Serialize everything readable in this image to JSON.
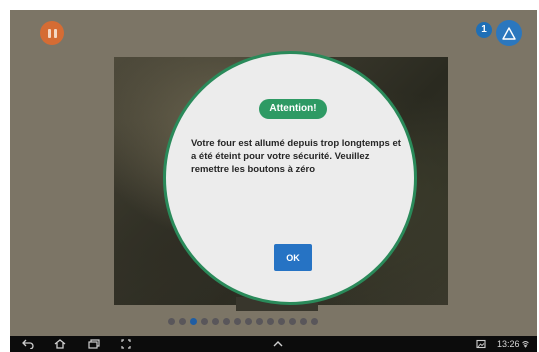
{
  "top_bar": {
    "pause_icon": "pause-icon",
    "notification_count": "1",
    "alert_icon": "warning-triangle-icon"
  },
  "dialog": {
    "title": "Attention!",
    "message": "Votre four est allumé depuis trop longtemps et a été éteint pour votre sécurité. Veuillez remettre les boutons à zéro",
    "ok_label": "OK",
    "colors": {
      "border": "#2a8a5a",
      "title_bg": "#2e9a64",
      "button_bg": "#2673c4"
    }
  },
  "carousel": {
    "dot_count": 14,
    "active_index": 2
  },
  "system_bar": {
    "icons": [
      "back-icon",
      "home-icon",
      "recent-apps-icon",
      "screenshot-icon",
      "chevron-up-icon",
      "gallery-icon"
    ],
    "time": "13:26"
  }
}
